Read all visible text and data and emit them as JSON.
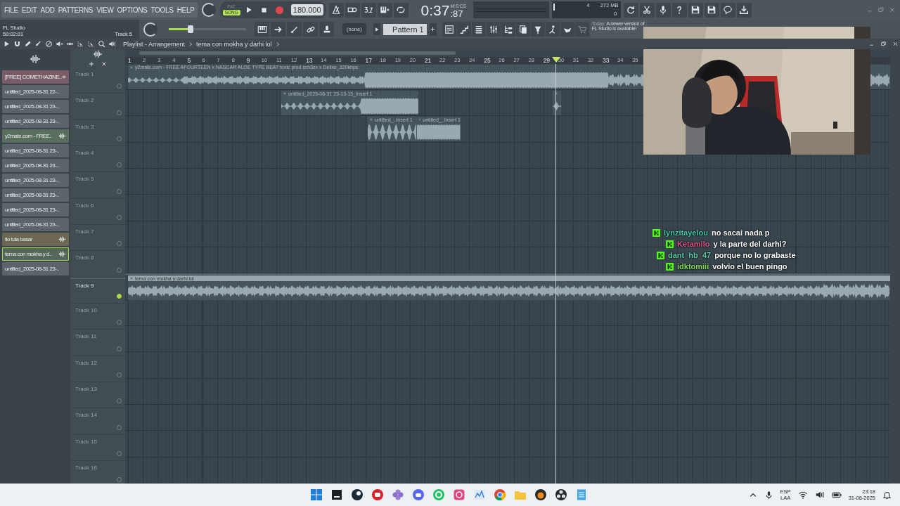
{
  "menu": [
    "FILE",
    "EDIT",
    "ADD",
    "PATTERNS",
    "VIEW",
    "OPTIONS",
    "TOOLS",
    "HELP"
  ],
  "transport": {
    "modes": [
      {
        "label": "PAT",
        "selected": false
      },
      {
        "label": "SONG",
        "selected": true
      }
    ],
    "tempo": "180.000",
    "time": "0:37",
    "time_fraction": ":87",
    "time_unit": "M:S:CS"
  },
  "monitor": {
    "count": "4",
    "memory": "272 MB",
    "load": "0"
  },
  "hint_panel": {
    "title": "FL Studio",
    "position": "50:02:01",
    "target": "Track 5"
  },
  "master_volume": {
    "level": 0.28
  },
  "pattern": {
    "channel": "(none)",
    "name": "Pattern 1"
  },
  "news": {
    "when": "Today",
    "lines": [
      "A newer version of",
      "FL Studio is available!"
    ]
  },
  "playlist": {
    "title": "Playlist - Arrangement",
    "pattern": "tema con mokha y darhi lol"
  },
  "browser": {
    "items": [
      {
        "label": "[FREE] COMETHAZINE..",
        "kind": "sample",
        "color": "#7a5d68",
        "selected": false
      },
      {
        "label": "untitled_2025-08-31 22-..",
        "kind": "recording",
        "color": "#5b646b",
        "selected": false
      },
      {
        "label": "untitled_2025-08-31 23-..",
        "kind": "recording",
        "color": "#5b646b",
        "selected": false
      },
      {
        "label": "untitled_2025-08-31 23-..",
        "kind": "recording",
        "color": "#5b646b",
        "selected": false
      },
      {
        "label": "y2mate.com - FREE..",
        "kind": "sample",
        "color": "#5a6e5e",
        "selected": false
      },
      {
        "label": "untitled_2025-08-31 23-..",
        "kind": "recording",
        "color": "#5b646b",
        "selected": false
      },
      {
        "label": "untitled_2025-08-31 23-..",
        "kind": "recording",
        "color": "#5b646b",
        "selected": false
      },
      {
        "label": "untitled_2025-08-31 23-..",
        "kind": "recording",
        "color": "#5b646b",
        "selected": false
      },
      {
        "label": "untitled_2025-08-31 23-..",
        "kind": "recording",
        "color": "#5b646b",
        "selected": false
      },
      {
        "label": "untitled_2025-08-31 23-..",
        "kind": "recording",
        "color": "#5b646b",
        "selected": false
      },
      {
        "label": "untitled_2025-08-31 23-..",
        "kind": "recording",
        "color": "#5b646b",
        "selected": false
      },
      {
        "label": "tio tula basar",
        "kind": "sample",
        "color": "#6b6752",
        "selected": false
      },
      {
        "label": "tema con mokha y d..",
        "kind": "sample",
        "color": "#55665a",
        "selected": true
      },
      {
        "label": "untitled_2025-08-31 23-..",
        "kind": "recording",
        "color": "#5b646b",
        "selected": false
      }
    ]
  },
  "ruler": [
    "1",
    "2",
    "3",
    "4",
    "5",
    "6",
    "7",
    "8",
    "9",
    "10",
    "11",
    "12",
    "13",
    "14",
    "15",
    "16",
    "17",
    "18",
    "19",
    "20",
    "21",
    "22",
    "23",
    "24",
    "25",
    "26",
    "27",
    "28",
    "29",
    "30",
    "31",
    "32",
    "33",
    "34",
    "35"
  ],
  "tracks": [
    {
      "label": "Track 1",
      "selected": false,
      "clips": [
        {
          "kind": "audio",
          "title": "y2mate.com - FREE AFOURTEEN x NASCAR ALOE TYPE BEAT  toxic prod sch3zx x Delixe_320kbps"
        }
      ]
    },
    {
      "label": "Track 2",
      "selected": false,
      "clips": [
        {
          "kind": "audio",
          "title": "untitled_2025-08-31 23-13-15_Insert 1"
        },
        {
          "kind": "audio"
        }
      ]
    },
    {
      "label": "Track 3",
      "selected": false,
      "clips": [
        {
          "kind": "audio",
          "title": "untitled_..Insert 1"
        },
        {
          "kind": "audio",
          "title": "untitled_..Insert 1"
        }
      ]
    },
    {
      "label": "Track 4",
      "selected": false
    },
    {
      "label": "Track 5",
      "selected": false
    },
    {
      "label": "Track 6",
      "selected": false
    },
    {
      "label": "Track 7",
      "selected": false
    },
    {
      "label": "Track 8",
      "selected": false
    },
    {
      "label": "Track 9",
      "selected": true,
      "clips": [
        {
          "kind": "audio",
          "title": "tema con mokha y darhi lol"
        }
      ]
    },
    {
      "label": "Track 10",
      "selected": false
    },
    {
      "label": "Track 11",
      "selected": false
    },
    {
      "label": "Track 12",
      "selected": false
    },
    {
      "label": "Track 13",
      "selected": false
    },
    {
      "label": "Track 14",
      "selected": false
    },
    {
      "label": "Track 15",
      "selected": false
    },
    {
      "label": "Track 16",
      "selected": false
    }
  ],
  "chat": [
    {
      "user": "lynzitayelou",
      "color": "#3fcfae",
      "message": "no sacai nada p"
    },
    {
      "user": "Ketamilo",
      "color": "#e0588e",
      "message": "y la parte del darhi?"
    },
    {
      "user": "dant_hb_47",
      "color": "#5ccfae",
      "message": "porque no lo grabaste"
    },
    {
      "user": "idktomiii",
      "color": "#7ee05a",
      "message": "volvio el buen pingo"
    }
  ],
  "taskbar": {
    "language": "ESP",
    "layout": "LAA",
    "time": "23:18",
    "date": "31-08-2025"
  }
}
